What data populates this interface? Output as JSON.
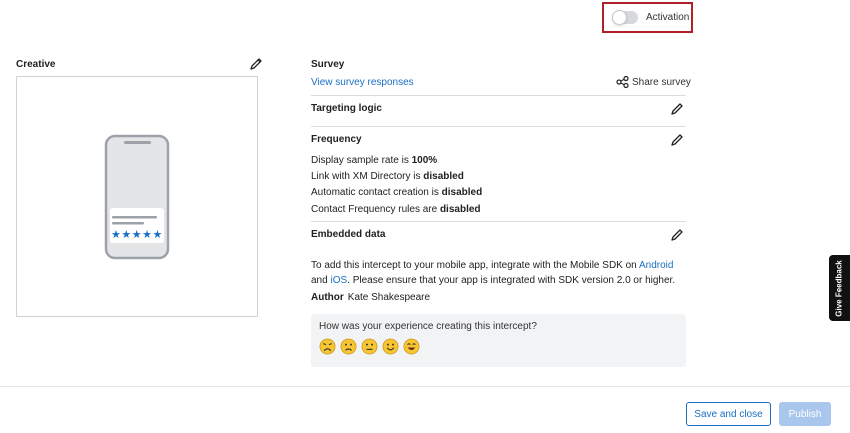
{
  "activation": {
    "label": "Activation",
    "enabled": false,
    "highlight_color": "#b0202b"
  },
  "creative": {
    "title": "Creative",
    "stars": [
      "★",
      "★",
      "★",
      "★",
      "★"
    ]
  },
  "survey": {
    "title": "Survey",
    "view_link": "View survey responses",
    "share_label": "Share survey"
  },
  "targeting": {
    "title": "Targeting logic"
  },
  "frequency": {
    "title": "Frequency",
    "lines": [
      {
        "prefix": "Display sample rate is ",
        "value": "100%"
      },
      {
        "prefix": "Link with XM Directory is ",
        "value": "disabled"
      },
      {
        "prefix": "Automatic contact creation is ",
        "value": "disabled"
      },
      {
        "prefix": "Contact Frequency rules are ",
        "value": "disabled"
      }
    ]
  },
  "embedded": {
    "title": "Embedded data"
  },
  "info": {
    "text1": "To add this intercept to your mobile app, integrate with the Mobile SDK on ",
    "link_android": "Android",
    "text2": " and ",
    "link_ios": "iOS",
    "text3": ". Please ensure that your app is integrated with SDK version 2.0 or higher."
  },
  "author": {
    "key": "Author",
    "value": "Kate Shakespeare"
  },
  "feedback": {
    "question": "How was your experience creating this intercept?",
    "emojis": [
      "very-unhappy",
      "unhappy",
      "neutral",
      "happy",
      "very-happy"
    ]
  },
  "buttons": {
    "save": "Save and close",
    "publish": "Publish"
  },
  "give_feedback": "Give Feedback",
  "colors": {
    "accent": "#1a6fc4",
    "star": "#1a6fc4",
    "emoji": "#f6c531"
  }
}
